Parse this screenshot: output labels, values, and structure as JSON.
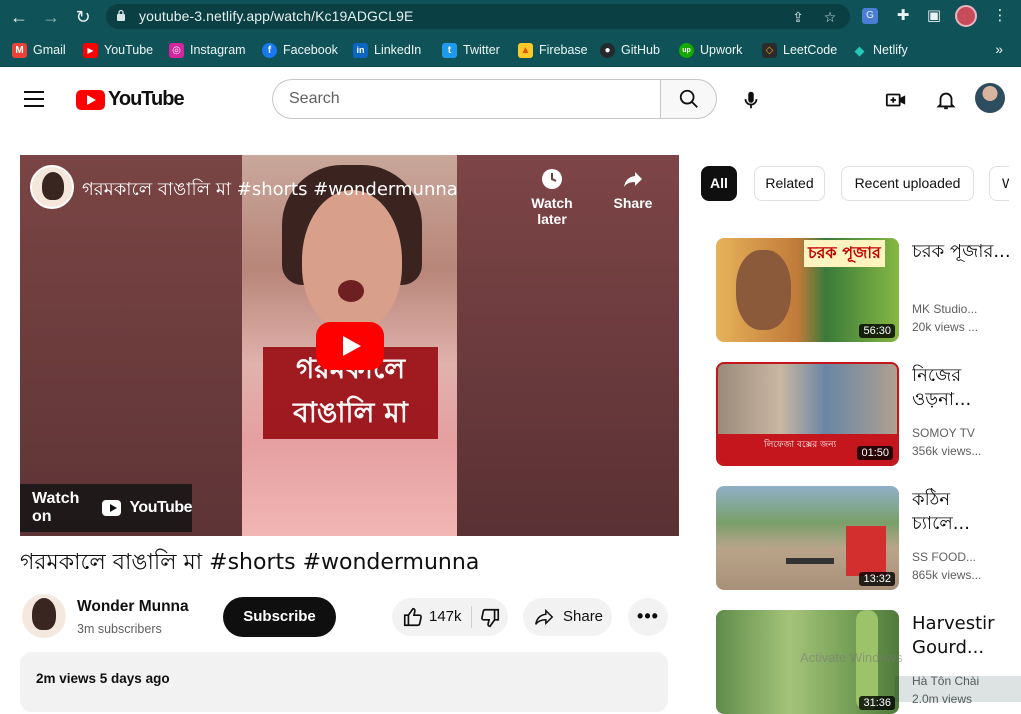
{
  "browser": {
    "url": "youtube-3.netlify.app/watch/Kc19ADGCL9E",
    "bookmarks": [
      {
        "label": "Gmail",
        "color": "#ea4335",
        "glyph": "M"
      },
      {
        "label": "YouTube",
        "color": "#ff0000",
        "glyph": "▶"
      },
      {
        "label": "Instagram",
        "color": "#d6249f",
        "glyph": "◎"
      },
      {
        "label": "Facebook",
        "color": "#1877f2",
        "glyph": "f"
      },
      {
        "label": "LinkedIn",
        "color": "#0a66c2",
        "glyph": "in"
      },
      {
        "label": "Twitter",
        "color": "#1d9bf0",
        "glyph": "t"
      },
      {
        "label": "Firebase",
        "color": "#ffca28",
        "glyph": "▲"
      },
      {
        "label": "GitHub",
        "color": "#24292e",
        "glyph": "●"
      },
      {
        "label": "Upwork",
        "color": "#14a800",
        "glyph": "up"
      },
      {
        "label": "LeetCode",
        "color": "#2b2b2b",
        "glyph": "◇"
      },
      {
        "label": "Netlify",
        "color": "#25c7b7",
        "glyph": "◆"
      }
    ],
    "more": "»"
  },
  "header": {
    "logo_text": "YouTube",
    "search_placeholder": "Search"
  },
  "player": {
    "overlay_title": "গরমকালে বাঙালি মা #shorts #wondermunna",
    "caption_line1": "গরমকালে",
    "caption_line2": "বাঙালি মা",
    "watch_later": "Watch later",
    "share": "Share",
    "watch_on": "Watch on",
    "watch_on_brand": "YouTube"
  },
  "video": {
    "title": "গরমকালে বাঙালি মা #shorts #wondermunna",
    "channel": "Wonder Munna",
    "subscribers": "3m subscribers",
    "subscribe_label": "Subscribe",
    "likes": "147k",
    "share_label": "Share",
    "more_label": "•••",
    "meta": "2m views 5 days ago"
  },
  "chips": [
    "All",
    "Related",
    "Recent uploaded",
    "W"
  ],
  "recommendations": [
    {
      "title": "চরক পূজার...",
      "channel": "MK Studio...",
      "views": "20k views ...",
      "duration": "56:30",
      "thumb_text": "চরক পূজার"
    },
    {
      "title": "নিজের ওড়না...",
      "channel": "SOMOY TV",
      "views": "356k views...",
      "duration": "01:50",
      "thumb_text": "লিফেজা বক্সের জন্য"
    },
    {
      "title": "কঠিন চ্যালে...",
      "channel": "SS FOOD...",
      "views": "865k views...",
      "duration": "13:32",
      "thumb_text": ""
    },
    {
      "title": "Harvestir Gourd...",
      "channel": "Hà Tôn Chài",
      "views": "2.0m views",
      "duration": "31:36",
      "thumb_text": ""
    }
  ],
  "overlay": {
    "activate_windows": "Activate Windows"
  }
}
